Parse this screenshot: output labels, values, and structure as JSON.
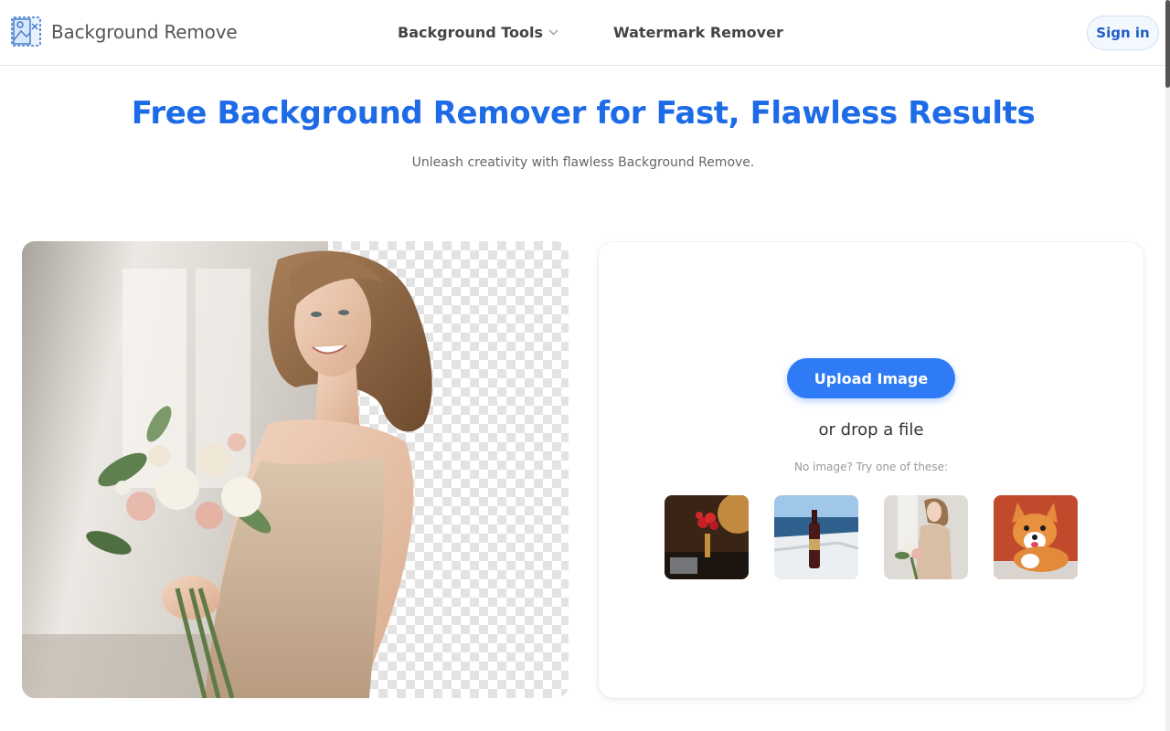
{
  "header": {
    "logo_text": "Background Remove",
    "nav": {
      "background_tools": "Background Tools",
      "watermark_remover": "Watermark Remover"
    },
    "sign_in": "Sign in"
  },
  "hero": {
    "title": "Free Background Remover for Fast, Flawless Results",
    "subtitle": "Unleash creativity with flawless Background Remove."
  },
  "upload": {
    "button_label": "Upload Image",
    "drop_text": "or drop a file",
    "try_text": "No image? Try one of these:",
    "samples": [
      "sample-flowers-room",
      "sample-wine-bottle-boat",
      "sample-woman-bouquet",
      "sample-corgi-dog"
    ]
  },
  "colors": {
    "brand_blue": "#1e6be8",
    "button_blue": "#2f7bf5",
    "border": "#e5e7eb"
  },
  "icons": {
    "logo": "image-edit-icon",
    "dropdown": "chevron-down-icon"
  }
}
